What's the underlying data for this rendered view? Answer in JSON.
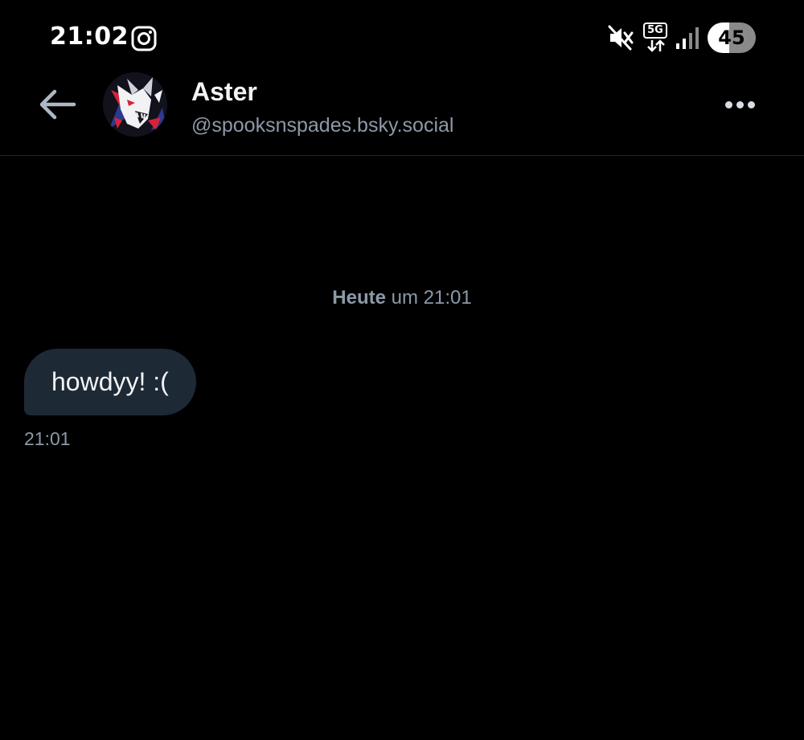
{
  "status_bar": {
    "time": "21:02",
    "network_label": "5G",
    "battery": "45",
    "battery_level": 0.45,
    "icons": [
      "instagram-icon",
      "mute-icon",
      "network-5g-icon",
      "signal-icon",
      "battery-icon"
    ]
  },
  "header": {
    "name": "Aster",
    "handle": "@spooksnspades.bsky.social",
    "back_icon": "arrow-left-icon",
    "more_icon": "more-horizontal-icon"
  },
  "conversation": {
    "date_separator_bold": "Heute",
    "date_separator_rest": " um 21:01",
    "messages": [
      {
        "text": "howdyy! :(",
        "time": "21:01",
        "direction": "incoming"
      }
    ]
  },
  "colors": {
    "background": "#000000",
    "bubble": "#1e2936",
    "muted_text": "#8c99a8",
    "divider": "#1f2630"
  }
}
